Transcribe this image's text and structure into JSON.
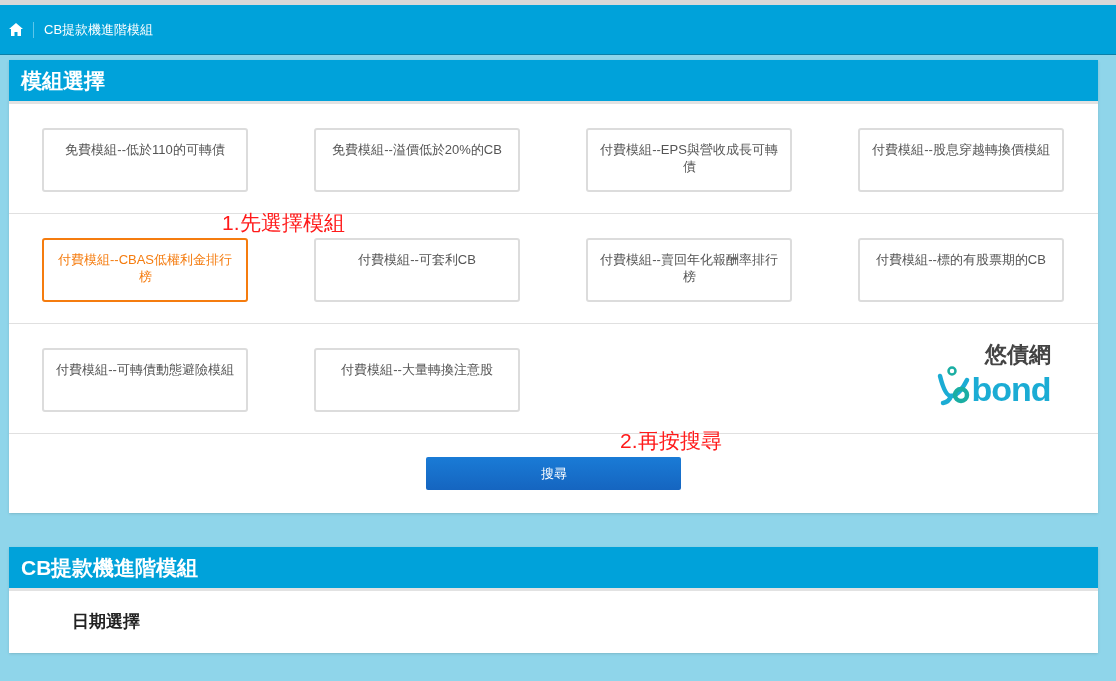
{
  "breadcrumb": {
    "title": "CB提款機進階模組"
  },
  "module_panel": {
    "title": "模組選擇",
    "rows": [
      [
        {
          "kind": "module",
          "label": "免費模組--低於110的可轉債",
          "selected": false
        },
        {
          "kind": "module",
          "label": "免費模組--溢價低於20%的CB",
          "selected": false
        },
        {
          "kind": "module",
          "label": "付費模組--EPS與營收成長可轉債",
          "selected": false
        },
        {
          "kind": "module",
          "label": "付費模組--股息穿越轉換價模組",
          "selected": false
        }
      ],
      [
        {
          "kind": "module",
          "label": "付費模組--CBAS低權利金排行榜",
          "selected": true
        },
        {
          "kind": "module",
          "label": "付費模組--可套利CB",
          "selected": false
        },
        {
          "kind": "module",
          "label": "付費模組--賣回年化報酬率排行榜",
          "selected": false
        },
        {
          "kind": "module",
          "label": "付費模組--標的有股票期的CB",
          "selected": false
        }
      ],
      [
        {
          "kind": "module",
          "label": "付費模組--可轉債動態避險模組",
          "selected": false
        },
        {
          "kind": "module",
          "label": "付費模組--大量轉換注意股",
          "selected": false
        },
        {
          "kind": "empty"
        },
        {
          "kind": "logo",
          "name": "悠債網",
          "wordmark": "bond"
        }
      ]
    ],
    "search_button": "搜尋"
  },
  "annotations": [
    {
      "text": "1.先選擇模組"
    },
    {
      "text": "2.再按搜尋"
    }
  ],
  "result_panel": {
    "title": "CB提款機進階模組",
    "date_label": "日期選擇"
  }
}
